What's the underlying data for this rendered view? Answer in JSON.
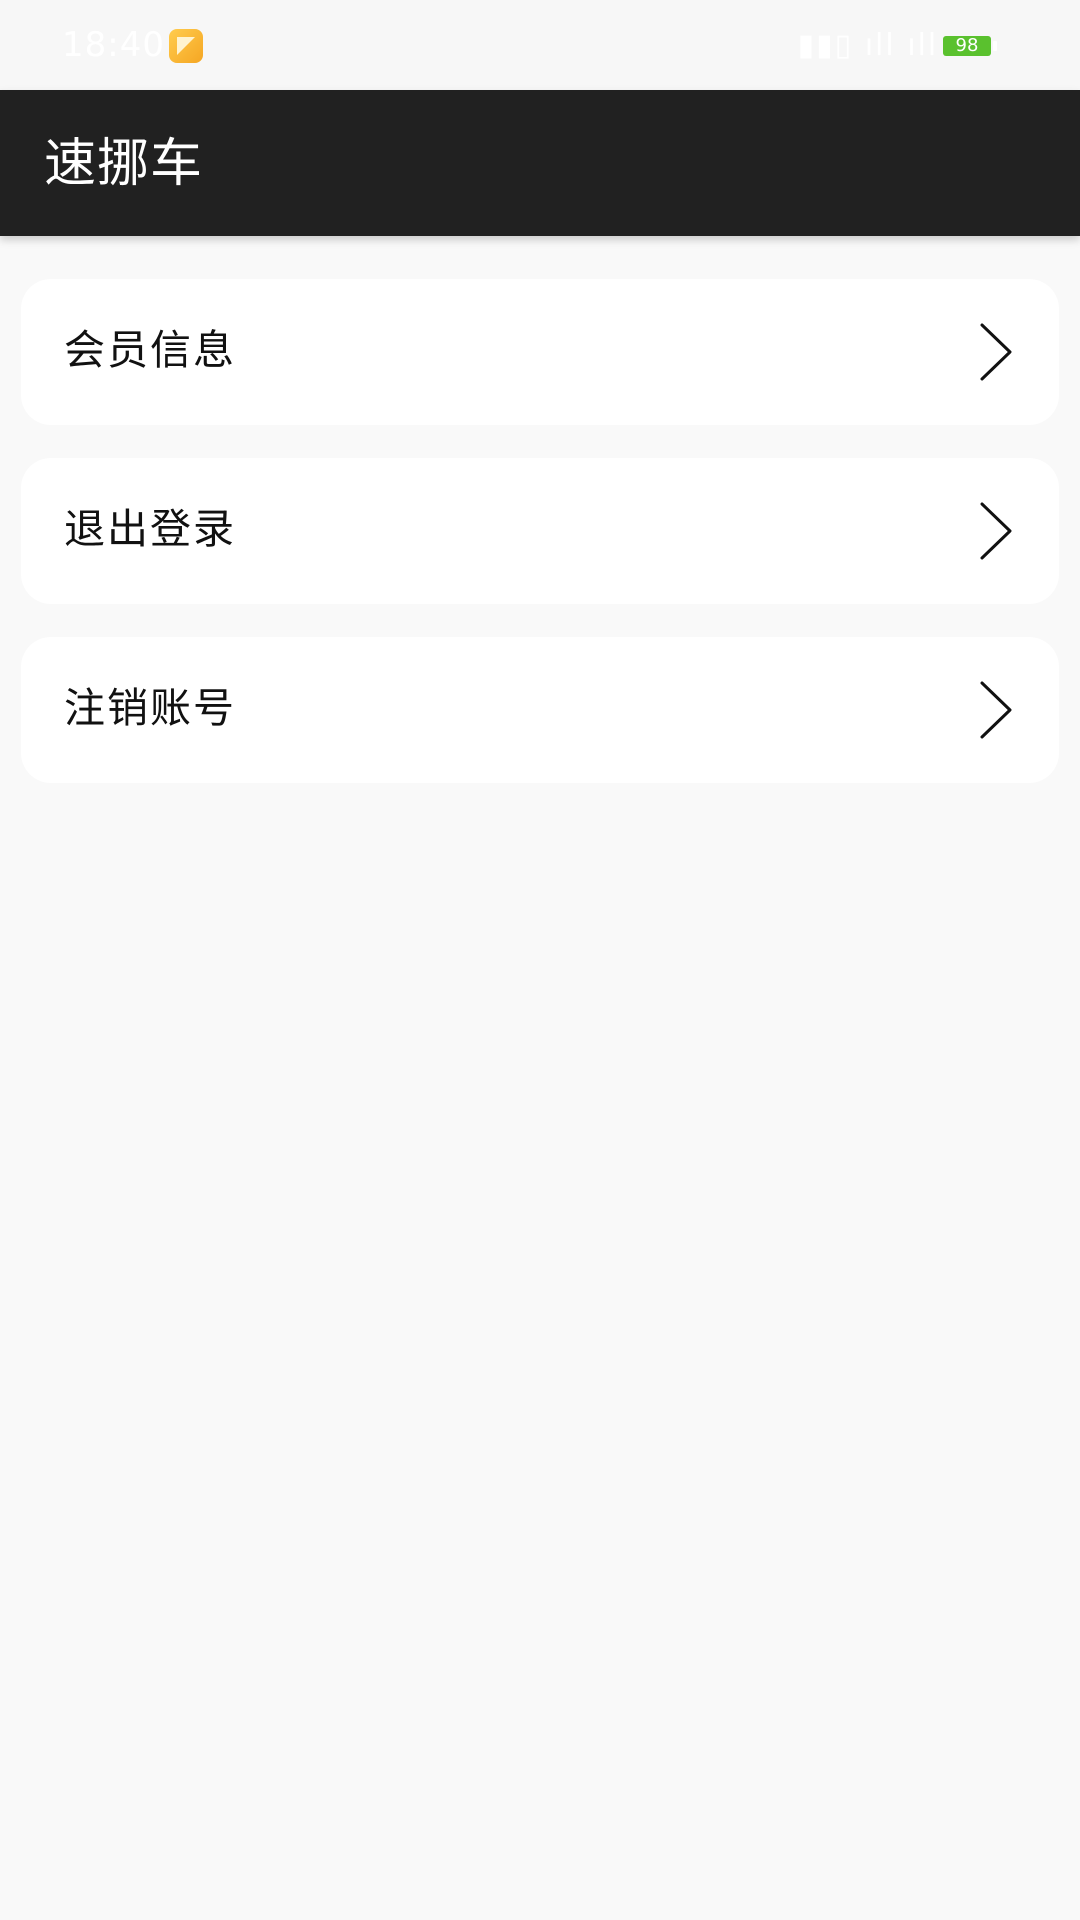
{
  "status_bar": {
    "time": "18:40",
    "app_icon": "notes-app-icon",
    "indicators": "▮▮▯ ıll ıll ⌔",
    "battery_level": "98",
    "colors": {
      "battery": "#5ac12e"
    }
  },
  "app_bar": {
    "title": "速挪车",
    "background": "#212121"
  },
  "menu": {
    "items": [
      {
        "label": "会员信息",
        "icon": "chevron-right-icon"
      },
      {
        "label": "退出登录",
        "icon": "chevron-right-icon"
      },
      {
        "label": "注销账号",
        "icon": "chevron-right-icon"
      }
    ]
  }
}
